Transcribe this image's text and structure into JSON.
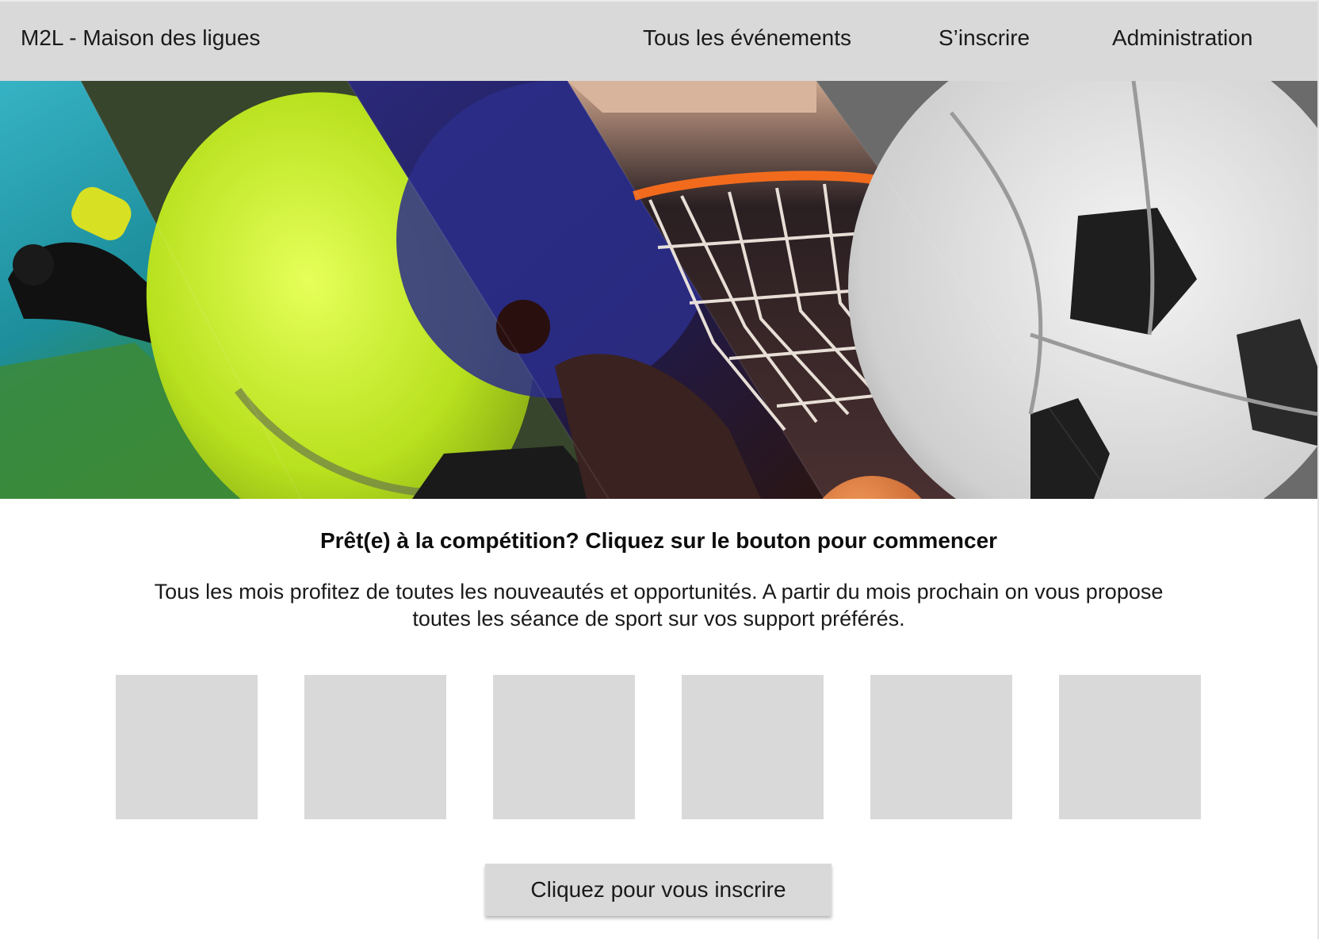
{
  "header": {
    "brand": "M2L - Maison des ligues",
    "nav": {
      "events": "Tous les événements",
      "register": "S’inscrire",
      "admin": "Administration"
    }
  },
  "hero": {
    "panels": [
      "diving",
      "tennis",
      "bowling",
      "basketball",
      "football"
    ]
  },
  "main": {
    "headline": "Prêt(e) à la compétition? Cliquez sur le bouton pour commencer",
    "lead": "Tous les mois profitez de toutes les nouveautés et opportunités. A partir du mois prochain on vous propose toutes les séance de sport sur vos support préférés.",
    "tiles_count": 6,
    "cta_label": "Cliquez pour vous inscrire"
  },
  "colors": {
    "header_bg": "#d9d9d9",
    "tile_bg": "#d9d9d9",
    "button_bg": "#d9d9d9"
  }
}
